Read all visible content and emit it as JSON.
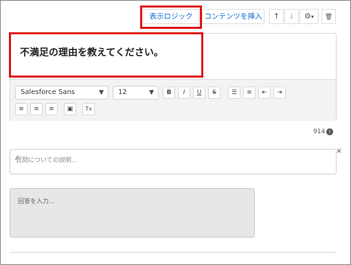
{
  "toolbar_top": {
    "display_logic_label": "表示ロジック",
    "insert_content_label": "コンテンツを挿入",
    "move_up_icon": "↑",
    "move_down_icon": "↓",
    "settings_icon": "⚙",
    "settings_caret": "▾",
    "delete_icon": "🗑"
  },
  "question": {
    "text": "不満足の理由を教えてください。"
  },
  "editor_toolbar": {
    "font_family": "Salesforce Sans",
    "font_size": "12",
    "caret": "▼",
    "bold": "B",
    "italic": "I",
    "underline": "U",
    "strike": "S",
    "bullet_list": "☰",
    "numbered_list": "≡",
    "outdent": "⇤",
    "indent": "⇥",
    "align_left": "≡",
    "align_center": "≡",
    "align_right": "≡",
    "image": "▣",
    "clear_format": "Tx"
  },
  "char_counter": "914",
  "info_glyph": "i",
  "close_glyph": "×",
  "description": {
    "placeholder": "質問についての説明..."
  },
  "answer": {
    "placeholder": "回答を入力..."
  },
  "colors": {
    "accent": "#0b6ed0",
    "highlight": "#e01010"
  }
}
